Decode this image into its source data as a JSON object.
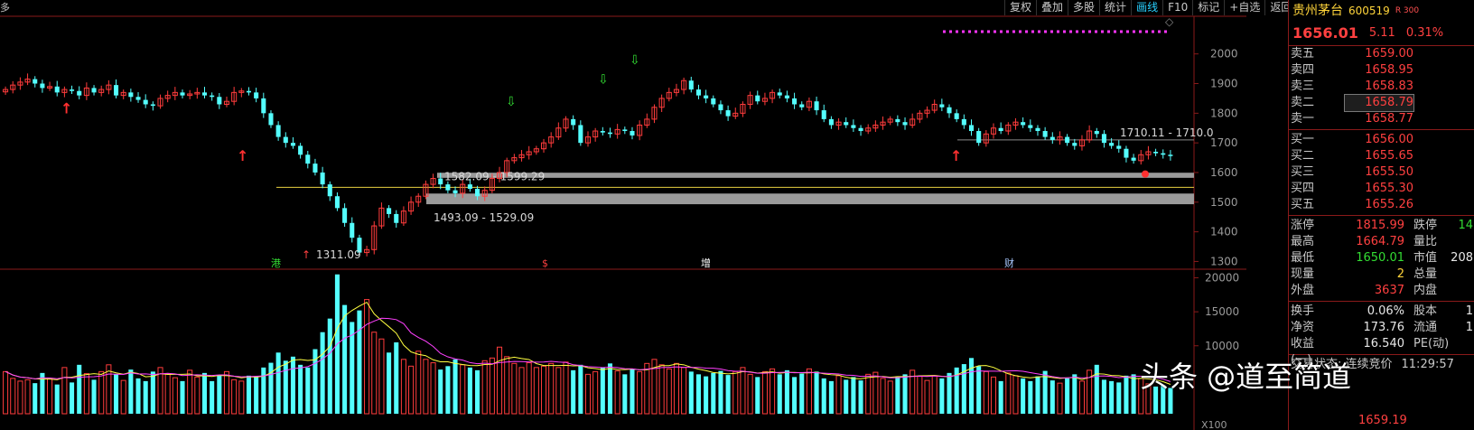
{
  "top_left_label": "多",
  "toolbar": [
    {
      "label": "复权",
      "active": false
    },
    {
      "label": "叠加",
      "active": false
    },
    {
      "label": "多股",
      "active": false
    },
    {
      "label": "统计",
      "active": false
    },
    {
      "label": "画线",
      "active": true
    },
    {
      "label": "F10",
      "active": false
    },
    {
      "label": "标记",
      "active": false
    },
    {
      "label": "+自选",
      "active": false
    },
    {
      "label": "返回",
      "active": false
    }
  ],
  "stock": {
    "name": "贵州茅台",
    "code": "600519",
    "tag": "R 300",
    "price": "1656.01",
    "change": "5.11",
    "pct": "0.31%"
  },
  "order_book": [
    {
      "label": "卖五",
      "price": "1659.00"
    },
    {
      "label": "卖四",
      "price": "1658.95"
    },
    {
      "label": "卖三",
      "price": "1658.83"
    },
    {
      "label": "卖二",
      "price": "1658.79",
      "selected": true
    },
    {
      "label": "卖一",
      "price": "1658.77"
    },
    {
      "label": "买一",
      "price": "1656.00"
    },
    {
      "label": "买二",
      "price": "1655.65"
    },
    {
      "label": "买三",
      "price": "1655.50"
    },
    {
      "label": "买四",
      "price": "1655.30"
    },
    {
      "label": "买五",
      "price": "1655.26"
    }
  ],
  "stats": [
    {
      "l1": "涨停",
      "v1": "1815.99",
      "c1": "red",
      "l2": "跌停",
      "v2": "14",
      "c2": "green"
    },
    {
      "l1": "最高",
      "v1": "1664.79",
      "c1": "red",
      "l2": "量比",
      "v2": "",
      "c2": "white"
    },
    {
      "l1": "最低",
      "v1": "1650.01",
      "c1": "green",
      "l2": "市值",
      "v2": "208",
      "c2": "white"
    },
    {
      "l1": "现量",
      "v1": "2",
      "c1": "yellow",
      "l2": "总量",
      "v2": "",
      "c2": "white"
    },
    {
      "l1": "外盘",
      "v1": "3637",
      "c1": "red",
      "l2": "内盘",
      "v2": "",
      "c2": "white"
    }
  ],
  "stats2": [
    {
      "l1": "换手",
      "v1": "0.06%",
      "c1": "white",
      "l2": "股本",
      "v2": "1",
      "c2": "white"
    },
    {
      "l1": "净资",
      "v1": "173.76",
      "c1": "white",
      "l2": "流通",
      "v2": "1",
      "c2": "white"
    },
    {
      "l1": "收益(一)",
      "v1": "16.540",
      "c1": "white",
      "l2": "PE(动)",
      "v2": "",
      "c2": "white"
    }
  ],
  "status": {
    "label": "交易状态: 连续竞价",
    "time": "11:29:57"
  },
  "last_price": "1659.19",
  "watermark": "头条 @道至简道",
  "chart_data": {
    "type": "candlestick",
    "price_axis": {
      "ticks": [
        2000,
        1900,
        1800,
        1700,
        1600,
        1500,
        1400,
        1300
      ],
      "range": [
        1280,
        2060
      ]
    },
    "volume_axis": {
      "ticks": [
        20000,
        15000,
        10000
      ],
      "range": [
        0,
        21000
      ],
      "unit_label": "X100"
    },
    "annotations": [
      {
        "text": "1311.09",
        "price": 1311.09
      },
      {
        "text": "1582.09 - 1599.29",
        "price": 1590
      },
      {
        "text": "1493.09 - 1529.09",
        "price": 1511
      },
      {
        "text": "1710.11 - 1710.0",
        "price": 1710
      }
    ],
    "zones": [
      {
        "from": 1582.09,
        "to": 1599.29
      },
      {
        "from": 1493.09,
        "to": 1529.09
      }
    ],
    "event_markers": [
      {
        "text": "港",
        "color": "#33dd33"
      },
      {
        "text": "$",
        "color": "#ff4040"
      },
      {
        "text": "增",
        "color": "#ffffff"
      },
      {
        "text": "财",
        "color": "#a8c8ff"
      }
    ],
    "closes": [
      1880,
      1895,
      1905,
      1915,
      1900,
      1885,
      1890,
      1870,
      1880,
      1875,
      1860,
      1885,
      1870,
      1880,
      1895,
      1860,
      1870,
      1855,
      1845,
      1830,
      1825,
      1850,
      1860,
      1870,
      1860,
      1865,
      1870,
      1860,
      1855,
      1830,
      1840,
      1870,
      1875,
      1870,
      1850,
      1800,
      1760,
      1720,
      1700,
      1690,
      1660,
      1630,
      1600,
      1560,
      1520,
      1480,
      1430,
      1380,
      1330,
      1340,
      1420,
      1480,
      1460,
      1430,
      1470,
      1500,
      1520,
      1560,
      1580,
      1560,
      1540,
      1530,
      1560,
      1545,
      1520,
      1540,
      1580,
      1600,
      1640,
      1650,
      1660,
      1670,
      1680,
      1700,
      1720,
      1750,
      1780,
      1760,
      1700,
      1720,
      1740,
      1735,
      1730,
      1745,
      1740,
      1725,
      1760,
      1780,
      1820,
      1850,
      1870,
      1880,
      1910,
      1880,
      1860,
      1850,
      1830,
      1810,
      1790,
      1800,
      1830,
      1860,
      1840,
      1850,
      1870,
      1860,
      1850,
      1830,
      1820,
      1840,
      1810,
      1780,
      1760,
      1770,
      1760,
      1750,
      1740,
      1750,
      1760,
      1770,
      1780,
      1770,
      1760,
      1780,
      1800,
      1810,
      1830,
      1820,
      1800,
      1780,
      1760,
      1740,
      1700,
      1730,
      1750,
      1740,
      1760,
      1770,
      1760,
      1750,
      1740,
      1720,
      1710,
      1720,
      1700,
      1690,
      1710,
      1740,
      1730,
      1700,
      1690,
      1680,
      1650,
      1640,
      1660,
      1670,
      1665,
      1660,
      1656
    ],
    "volumes": [
      6200,
      5200,
      4800,
      5000,
      4500,
      6000,
      5200,
      4300,
      6800,
      4600,
      7200,
      5900,
      5000,
      6200,
      7200,
      5800,
      4900,
      6500,
      5200,
      4800,
      6200,
      6800,
      5900,
      5300,
      4800,
      6400,
      5400,
      6000,
      4800,
      5600,
      6200,
      5000,
      4800,
      5600,
      5400,
      6800,
      7500,
      9000,
      7800,
      8400,
      7200,
      6800,
      9500,
      12000,
      14000,
      20500,
      16000,
      13500,
      15200,
      16800,
      12000,
      11000,
      9000,
      10500,
      8000,
      7000,
      9200,
      8000,
      7500,
      6500,
      7000,
      8000,
      7200,
      6800,
      6400,
      7800,
      8200,
      9800,
      8400,
      7400,
      6800,
      7500,
      6800,
      7000,
      7400,
      6800,
      7600,
      6400,
      7200,
      5800,
      6200,
      6800,
      7400,
      6300,
      5800,
      6600,
      6200,
      7400,
      8000,
      7200,
      6600,
      7400,
      6800,
      6200,
      5800,
      5500,
      6000,
      6300,
      5700,
      6200,
      6800,
      5800,
      5400,
      6200,
      6600,
      5800,
      6400,
      5400,
      5900,
      6600,
      6200,
      5200,
      4800,
      5600,
      5000,
      5400,
      4900,
      5800,
      6100,
      5200,
      4800,
      5400,
      5800,
      6400,
      5500,
      4900,
      5600,
      5200,
      6000,
      6800,
      7300,
      8200,
      7000,
      6200,
      5400,
      4800,
      6000,
      5600,
      5200,
      4800,
      5500,
      6300,
      4900,
      4500,
      5200,
      5800,
      4800,
      6400,
      7200,
      5000,
      4800,
      4600,
      5600,
      5800,
      5200,
      4400,
      4000,
      4200,
      3800
    ]
  }
}
